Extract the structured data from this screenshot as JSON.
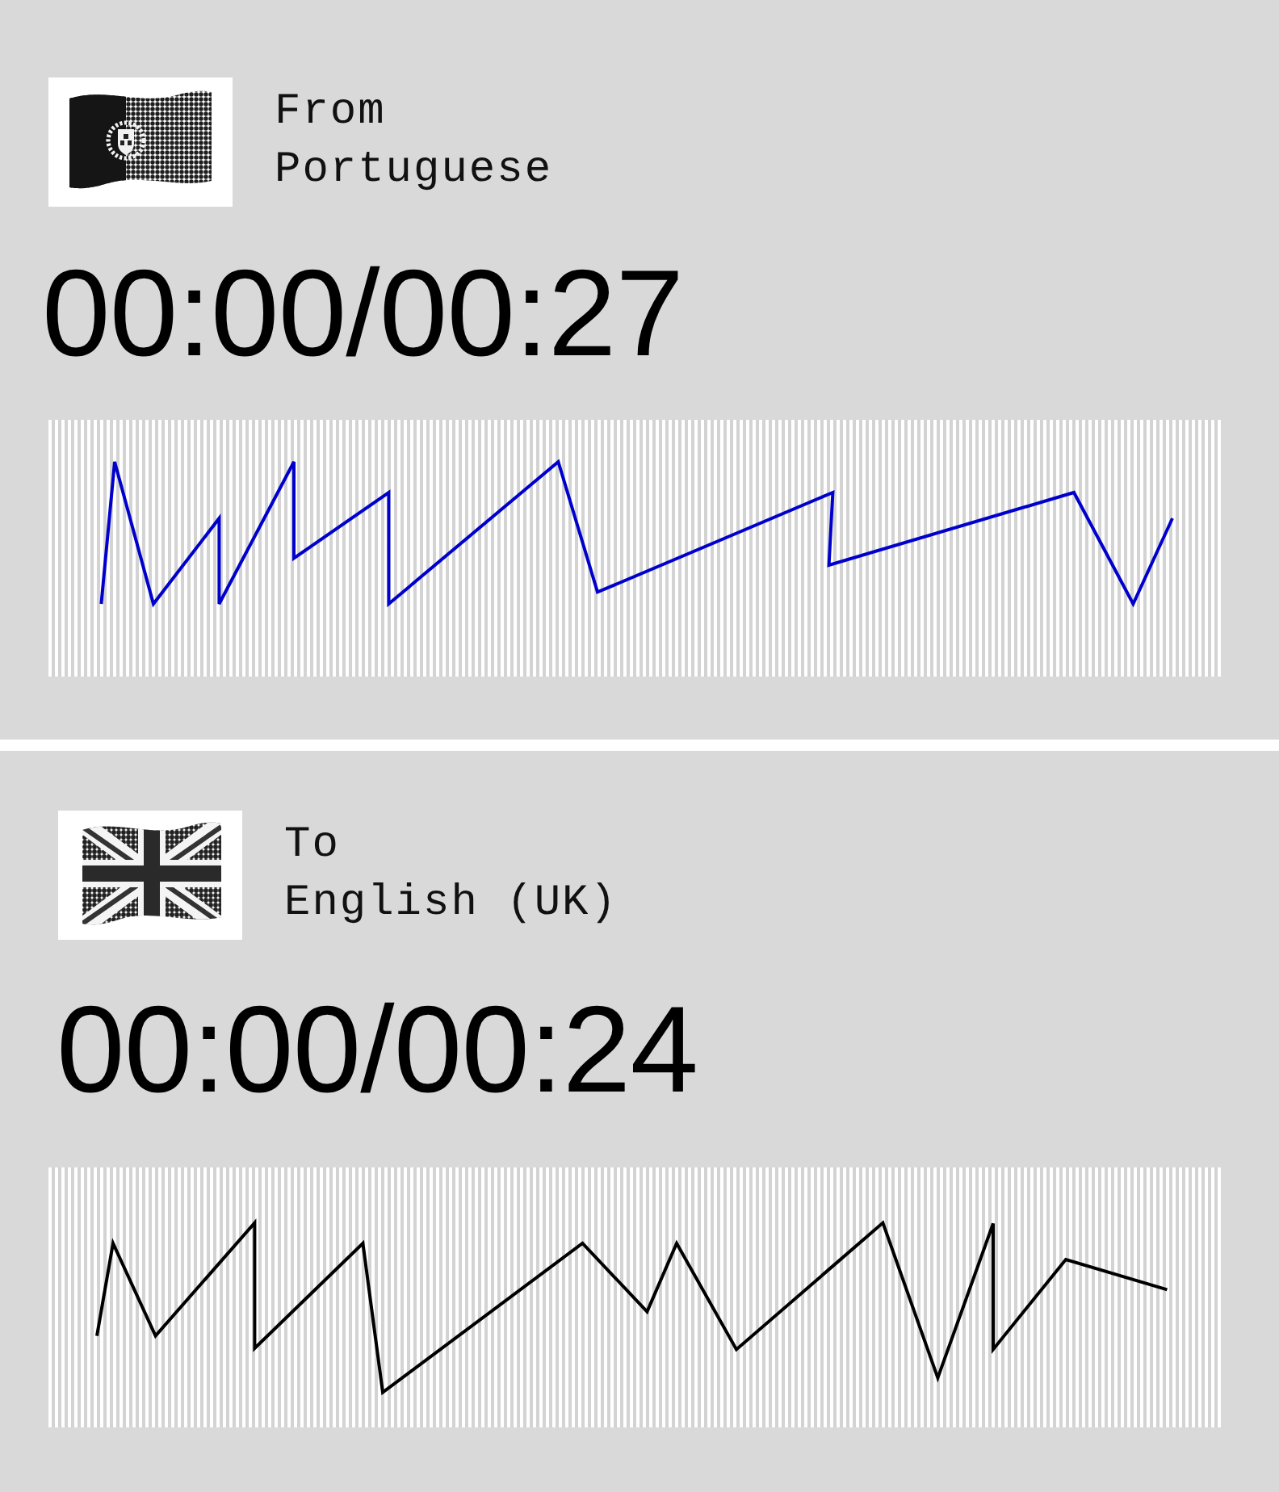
{
  "panels": [
    {
      "direction": "From",
      "language": "Portuguese",
      "time": "00:00/00:27",
      "color": "#0000cc"
    },
    {
      "direction": "To",
      "language": "English (UK)",
      "time": "00:00/00:24",
      "color": "#000000"
    }
  ]
}
